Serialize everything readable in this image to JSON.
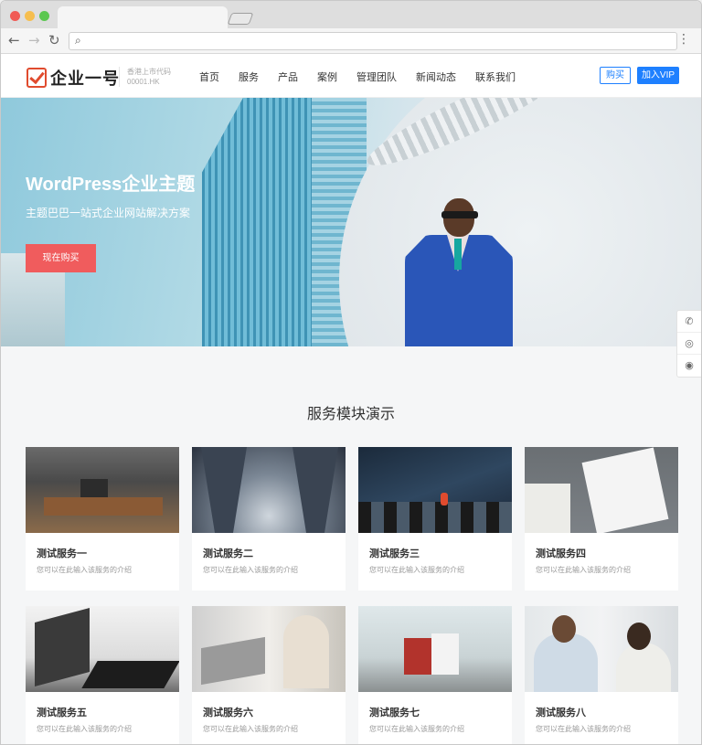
{
  "browser": {
    "menu_icon": "more-vert-icon"
  },
  "header": {
    "logo_text": "企业一号",
    "stock_line1": "香港上市代码",
    "stock_line2": "00001.HK",
    "nav": [
      "首页",
      "服务",
      "产品",
      "案例",
      "管理团队",
      "新闻动态",
      "联系我们"
    ],
    "buy_label": "购买",
    "vip_label": "加入VIP"
  },
  "hero": {
    "title": "WordPress企业主题",
    "subtitle": "主题巴巴一站式企业网站解决方案",
    "button": "现在购买"
  },
  "services": {
    "title": "服务模块演示",
    "items": [
      {
        "title": "测试服务一",
        "desc": "您可以在此输入该服务的介绍"
      },
      {
        "title": "测试服务二",
        "desc": "您可以在此输入该服务的介绍"
      },
      {
        "title": "测试服务三",
        "desc": "您可以在此输入该服务的介绍"
      },
      {
        "title": "测试服务四",
        "desc": "您可以在此输入该服务的介绍"
      },
      {
        "title": "测试服务五",
        "desc": "您可以在此输入该服务的介绍"
      },
      {
        "title": "测试服务六",
        "desc": "您可以在此输入该服务的介绍"
      },
      {
        "title": "测试服务七",
        "desc": "您可以在此输入该服务的介绍"
      },
      {
        "title": "测试服务八",
        "desc": "您可以在此输入该服务的介绍"
      }
    ]
  },
  "side_float": {
    "icons": [
      "phone-icon",
      "wechat-icon",
      "weibo-icon"
    ]
  }
}
